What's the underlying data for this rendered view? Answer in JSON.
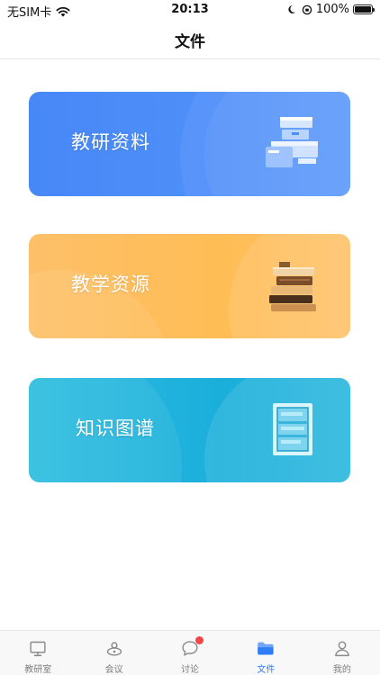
{
  "status_bar": {
    "carrier": "无SIM卡",
    "time": "20:13",
    "battery": "100%",
    "battery_level": 1.0
  },
  "header": {
    "title": "文件"
  },
  "cards": [
    {
      "label": "教研资料",
      "icon": "printer-boxes-icon",
      "color": "#4a8bf8"
    },
    {
      "label": "教学资源",
      "icon": "book-stack-icon",
      "color": "#ffbe5c"
    },
    {
      "label": "知识图谱",
      "icon": "bookshelf-icon",
      "color": "#22b3dc"
    }
  ],
  "tab_bar": {
    "tabs": [
      {
        "label": "教研室",
        "icon": "monitor-icon",
        "active": false
      },
      {
        "label": "会议",
        "icon": "meeting-icon",
        "active": false
      },
      {
        "label": "讨论",
        "icon": "chat-bubble-icon",
        "active": false,
        "badge": true
      },
      {
        "label": "文件",
        "icon": "folder-icon",
        "active": true
      },
      {
        "label": "我的",
        "icon": "person-icon",
        "active": false
      }
    ],
    "active_color": "#2e7cf6",
    "inactive_color": "#7d7d7d"
  }
}
